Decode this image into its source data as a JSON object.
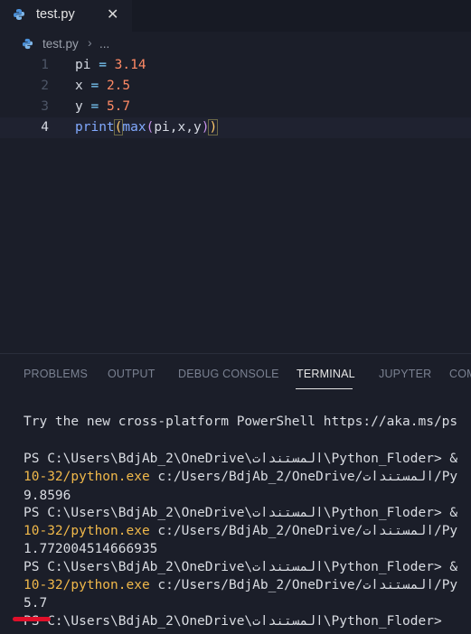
{
  "tab": {
    "filename": "test.py",
    "close": "✕"
  },
  "breadcrumb": {
    "file": "test.py",
    "separator": "›",
    "more": "..."
  },
  "editor": {
    "line_numbers": [
      "1",
      "2",
      "3",
      "4"
    ],
    "lines": [
      {
        "var": "pi",
        "op": " = ",
        "num": "3.14"
      },
      {
        "var": "x",
        "op": " = ",
        "num": "2.5"
      },
      {
        "var": "y",
        "op": " = ",
        "num": "5.7"
      },
      {
        "fn1": "print",
        "open1": "(",
        "fn2": "max",
        "open2": "(",
        "args": "pi,x,y",
        "close2": ")",
        "close1": ")"
      }
    ]
  },
  "panel": {
    "tabs": [
      "PROBLEMS",
      "OUTPUT",
      "DEBUG CONSOLE",
      "TERMINAL",
      "JUPYTER",
      "COM"
    ],
    "active_tab": "TERMINAL"
  },
  "terminal": {
    "banner": "Try the new cross-platform PowerShell https://aka.ms/ps",
    "prompt": "PS C:\\Users\\BdjAb_2\\OneDrive\\المستندات\\Python_Floder> &",
    "exe": "10-32/python.exe",
    "script": " c:/Users/BdjAb_2/OneDrive/المستندات/Py",
    "outputs": [
      "9.8596",
      "1.772004514666935",
      "5.7"
    ],
    "last_prompt": "PS C:\\Users\\BdjAb_2\\OneDrive\\المستندات\\Python_Floder>"
  },
  "colors": {
    "accent_red": "#e0102a",
    "exe_yellow": "#f0b84a"
  }
}
